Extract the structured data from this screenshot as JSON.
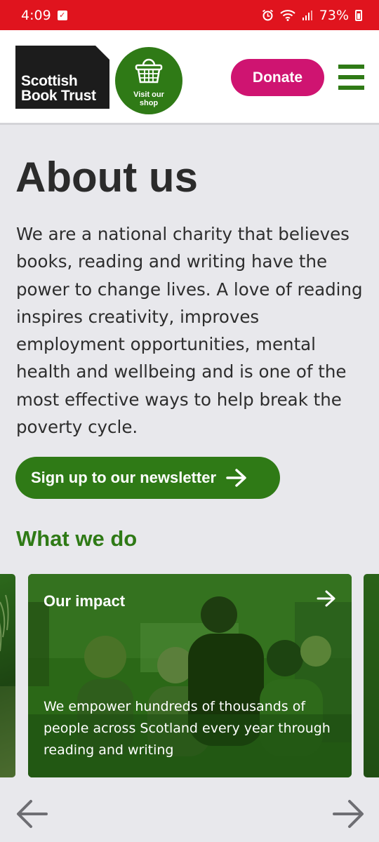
{
  "status_bar": {
    "time": "4:09",
    "battery": "73%",
    "icons": [
      "check-notification-icon",
      "alarm-icon",
      "wifi-icon",
      "signal-icon",
      "battery-icon"
    ]
  },
  "header": {
    "logo_line1": "Scottish",
    "logo_line2": "Book Trust",
    "shop_label": "Visit our shop",
    "donate_label": "Donate"
  },
  "main": {
    "title": "About us",
    "intro": "We are a national charity that believes books, reading and writing have the power to change lives. A love of reading inspires creativity, improves employment opportunities, mental health and wellbeing and is one of the most effective ways to help break the poverty cycle.",
    "newsletter_label": "Sign up to our newsletter",
    "section_heading": "What we do"
  },
  "carousel": {
    "cards": [
      {
        "title": "Our impact",
        "description": "We empower hundreds of thousands of people across Scotland every year through reading and writing"
      }
    ]
  },
  "colors": {
    "status_red": "#e0141e",
    "brand_green": "#2f7a16",
    "donate_pink": "#cf1471",
    "page_bg": "#e8e8ec"
  }
}
